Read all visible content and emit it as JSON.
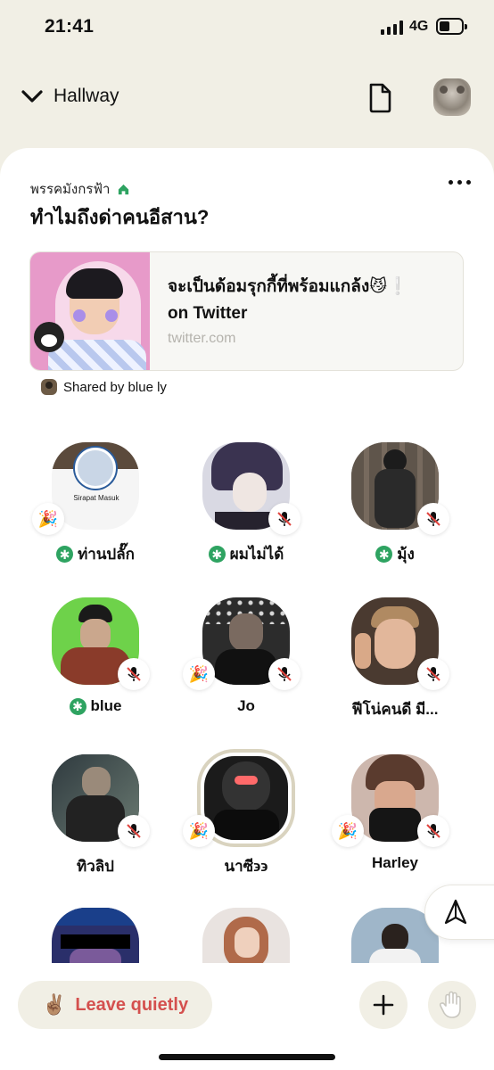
{
  "status_bar": {
    "time": "21:41",
    "network": "4G",
    "battery_level": 0.35
  },
  "header": {
    "back_label": "Hallway",
    "icons": [
      "chevron-down-icon",
      "document-icon",
      "profile-avatar"
    ]
  },
  "room": {
    "club_name": "พรรคมังกรฟ้า",
    "title": "ทำไมถึงด่าคนอีสาน?",
    "link": {
      "title_line1": "จะเป็นด้อมรุกกี้ที่พร้อมแกล้ง😼❕",
      "title_line2": "on Twitter",
      "domain": "twitter.com"
    },
    "shared_by": "Shared by blue ly"
  },
  "speakers": [
    {
      "name": "ท่านปลั๊ก",
      "moderator": true,
      "muted": false,
      "party": true
    },
    {
      "name": "ผมไม่ได้",
      "moderator": true,
      "muted": true,
      "party": false
    },
    {
      "name": "มุ้ง",
      "moderator": true,
      "muted": true,
      "party": false
    },
    {
      "name": "blue",
      "moderator": true,
      "muted": true,
      "party": false
    },
    {
      "name": "Jo",
      "moderator": false,
      "muted": true,
      "party": true
    },
    {
      "name": "ฟีโน่คนดี มี...",
      "moderator": false,
      "muted": true,
      "party": false
    },
    {
      "name": "ทิวลิป",
      "moderator": false,
      "muted": true,
      "party": false
    },
    {
      "name": "นาซี϶϶",
      "moderator": false,
      "muted": false,
      "party": true,
      "speaking": true
    },
    {
      "name": "Harley",
      "moderator": false,
      "muted": true,
      "party": true
    }
  ],
  "avatar_overlay_text": {
    "card_name": "Sirapat Masuk"
  },
  "bottom": {
    "leave_label": "Leave quietly",
    "leave_emoji": "✌🏽"
  },
  "colors": {
    "background": "#f1efe5",
    "moderator_green": "#2ea361",
    "leave_red": "#d4504e",
    "mute_red": "#e0443e"
  }
}
